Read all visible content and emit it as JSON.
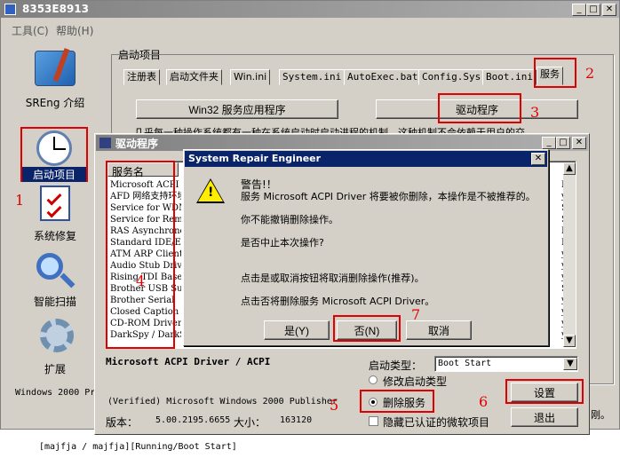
{
  "main_window": {
    "title": "8353E8913",
    "menu": [
      "工具(C)",
      "帮助(H)"
    ]
  },
  "sidebar": {
    "items": [
      {
        "label": "SREng 介绍"
      },
      {
        "label": "启动项目"
      },
      {
        "label": "系统修复"
      },
      {
        "label": "智能扫描"
      },
      {
        "label": "扩展"
      }
    ]
  },
  "startup": {
    "group_title": "启动项目",
    "tabs": [
      "注册表",
      "启动文件夹",
      "Win.ini",
      "System.ini",
      "AutoExec.bat",
      "Config.Sys",
      "Boot.ini",
      "服务"
    ],
    "win32_button": "Win32 服务应用程序",
    "driver_button": "驱动程序",
    "desc_fragment": "几乎每一种操作系统都有一种在系统启动时启动进程的机制，这种机制不会依赖于用户的交"
  },
  "status_bar": {
    "text": "Windows 2000 Pr",
    "bottom_fragment": "[majfja / majfja][Running/Boot Start]",
    "right_fragment": "刚。"
  },
  "driver_window": {
    "title": "驱动程序",
    "list_header": "服务名",
    "rows": [
      "Microsoft ACPI Driver",
      "AFD 网络支持环境",
      "Service for WDM",
      "Service for Remote",
      "RAS Asynchronous",
      "Standard IDE/ESDI",
      "ATM ARP Client",
      "Audio Stub Driver",
      "Rising TDI Base",
      "Brother USB Support",
      "Brother Serial",
      "Closed Caption",
      "CD-ROM Driver",
      "DarkSpy / DarkSpy"
    ],
    "right_col": [
      "RS",
      "ys",
      "SY",
      "SY",
      "RS",
      "RS",
      "ys",
      "ys",
      "ys",
      "SY",
      "ys",
      "ys",
      "ys",
      "ys",
      "Sp"
    ],
    "selected_name": "Microsoft ACPI Driver / ACPI",
    "publisher": "(Verified) Microsoft Windows 2000 Publisher",
    "version_label": "版本：",
    "version": "5.00.2195.6655",
    "size_label": "大小：",
    "size": "163120",
    "start_type_label": "启动类型：",
    "start_type_value": "Boot Start",
    "radio_modify": "修改启动类型",
    "radio_delete": "删除服务",
    "checkbox_hide": "隐藏已认证的微软项目",
    "set_button": "设置",
    "exit_button": "退出"
  },
  "dialog": {
    "title": "System Repair Engineer",
    "warning_title": "警告!！",
    "line1": "服务 Microsoft ACPI Driver 将要被你删除，本操作是不被推荐的。",
    "line2": "你不能撤销删除操作。",
    "line3": "是否中止本次操作?",
    "line4": "点击是或取消按钮将取消删除操作(推荐)。",
    "line5": "点击否将删除服务 Microsoft ACPI Driver。",
    "yes": "是(Y)",
    "no": "否(N)",
    "cancel": "取消"
  },
  "annotations": [
    "1",
    "2",
    "3",
    "4",
    "5",
    "6",
    "7"
  ]
}
